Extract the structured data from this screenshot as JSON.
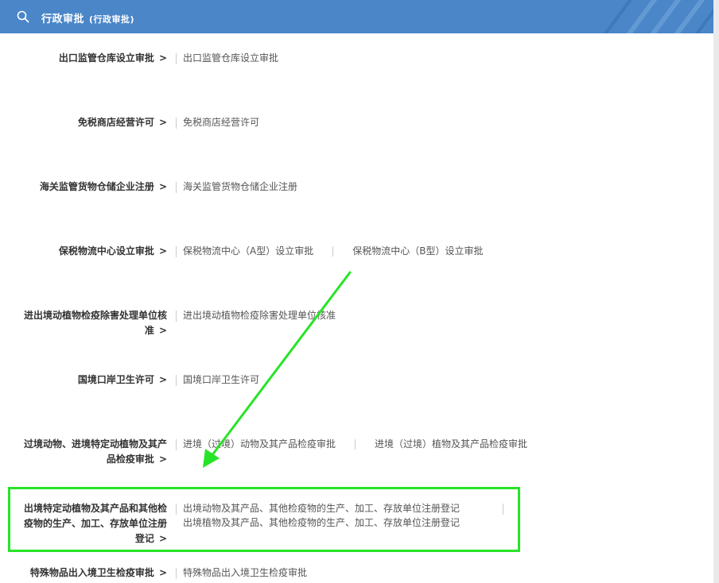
{
  "header": {
    "title": "行政审批",
    "subtitle": "(行政审批)",
    "search_icon": "search-icon",
    "background_color": "#4a86c8"
  },
  "chevron": ">",
  "rows": [
    {
      "category": "出口监管仓库设立审批",
      "items": [
        "出口监管仓库设立审批"
      ]
    },
    {
      "category": "免税商店经营许可",
      "items": [
        "免税商店经营许可"
      ]
    },
    {
      "category": "海关监管货物仓储企业注册",
      "items": [
        "海关监管货物仓储企业注册"
      ]
    },
    {
      "category": "保税物流中心设立审批",
      "items": [
        "保税物流中心（A型）设立审批",
        "保税物流中心（B型）设立审批"
      ]
    },
    {
      "category_line1": "进出境动植物检疫除害处理单位核",
      "category_line2": "准",
      "items": [
        "进出境动植物检疫除害处理单位核准"
      ]
    },
    {
      "category": "国境口岸卫生许可",
      "items": [
        "国境口岸卫生许可"
      ]
    },
    {
      "category_line1": "过境动物、进境特定动植物及其产",
      "category_line2": "品检疫审批",
      "items": [
        "进境（过境）动物及其产品检疫审批",
        "进境（过境）植物及其产品检疫审批"
      ]
    },
    {
      "category_line1": "出境特定动植物及其产品和其他检",
      "category_line2": "疫物的生产、加工、存放单位注册",
      "category_line3": "登记",
      "items": [
        "出境动物及其产品、其他检疫物的生产、加工、存放单位注册登记",
        "出境植物及其产品、其他检疫物的生产、加工、存放单位注册登记"
      ]
    },
    {
      "category": "特殊物品出入境卫生检疫审批",
      "items": [
        "特殊物品出入境卫生检疫审批"
      ]
    }
  ],
  "annotation": {
    "highlight_color": "#27e427",
    "arrow_color": "#27e427"
  }
}
